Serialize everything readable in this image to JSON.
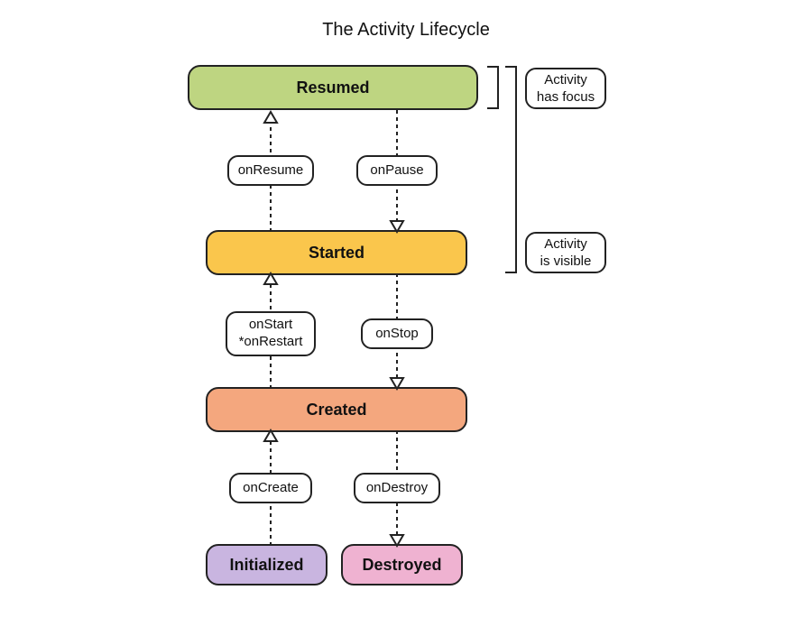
{
  "title": "The Activity Lifecycle",
  "states": {
    "resumed": {
      "label": "Resumed",
      "color": "#bed581"
    },
    "started": {
      "label": "Started",
      "color": "#fac64c"
    },
    "created": {
      "label": "Created",
      "color": "#f4a77e"
    },
    "initialized": {
      "label": "Initialized",
      "color": "#c9b5e0"
    },
    "destroyed": {
      "label": "Destroyed",
      "color": "#efb2d1"
    }
  },
  "transitions": {
    "onResume": "onResume",
    "onPause": "onPause",
    "onStart": "onStart\n*onRestart",
    "onStop": "onStop",
    "onCreate": "onCreate",
    "onDestroy": "onDestroy"
  },
  "sideLabels": {
    "focus": "Activity\nhas focus",
    "visible": "Activity\nis visible"
  }
}
